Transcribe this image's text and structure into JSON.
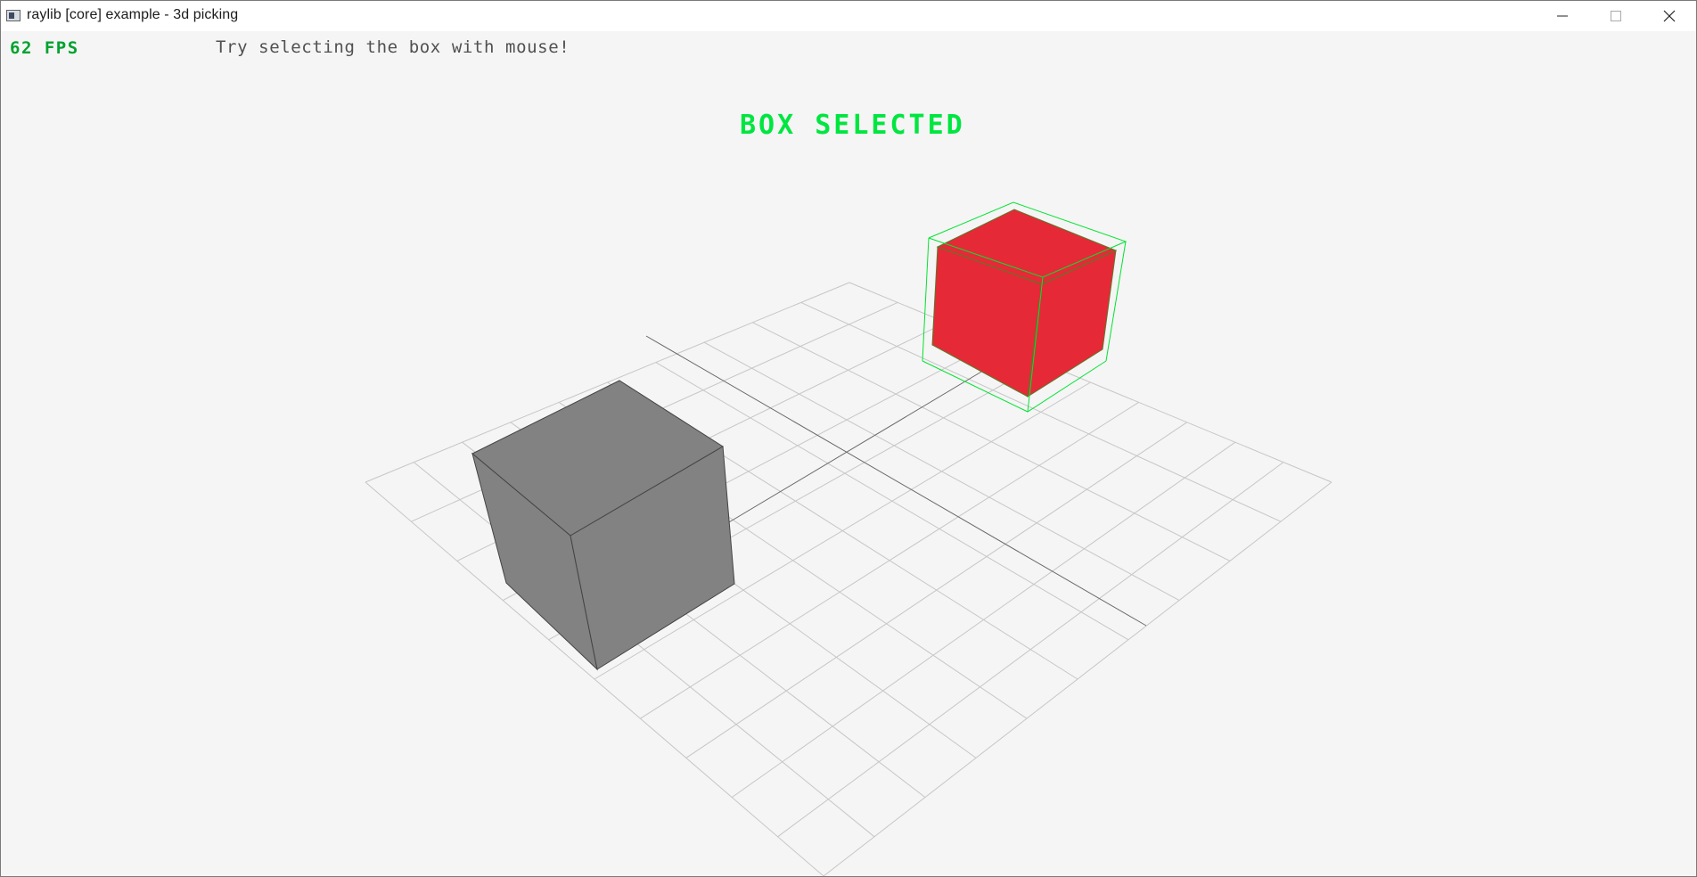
{
  "window": {
    "title": "raylib [core] example - 3d picking",
    "controls": {
      "minimize": "minimize",
      "maximize": "maximize",
      "close": "close"
    }
  },
  "hud": {
    "fps": "62 FPS",
    "hint": "Try selecting the box with mouse!",
    "status": "BOX SELECTED"
  },
  "scene": {
    "background_color": "#f5f5f5",
    "grid_color": "#c8c8c8",
    "axis_color": "#646464",
    "selected_cube_color": "#e62937",
    "unselected_cube_color": "#828282",
    "bounding_box_color": "#00e430"
  }
}
